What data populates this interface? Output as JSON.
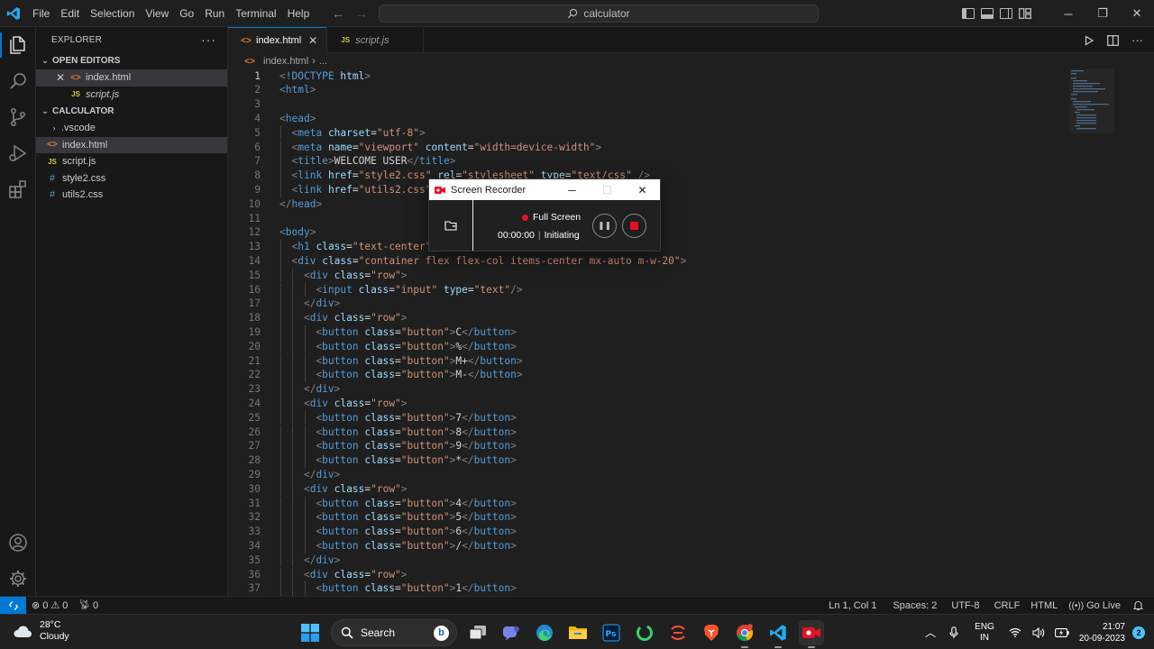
{
  "titlebar": {
    "menu": [
      "File",
      "Edit",
      "Selection",
      "View",
      "Go",
      "Run",
      "Terminal",
      "Help"
    ],
    "search_text": "calculator"
  },
  "explorer": {
    "title": "EXPLORER",
    "open_editors_label": "OPEN EDITORS",
    "open_editors": [
      {
        "name": "index.html",
        "type": "html"
      },
      {
        "name": "script.js",
        "type": "js"
      }
    ],
    "folder_label": "CALCULATOR",
    "files": [
      {
        "name": ".vscode",
        "type": "folder"
      },
      {
        "name": "index.html",
        "type": "html"
      },
      {
        "name": "script.js",
        "type": "js"
      },
      {
        "name": "style2.css",
        "type": "css"
      },
      {
        "name": "utils2.css",
        "type": "css"
      }
    ]
  },
  "tabs": [
    {
      "label": "index.html",
      "type": "html",
      "active": true
    },
    {
      "label": "script.js",
      "type": "js",
      "active": false
    }
  ],
  "breadcrumb": {
    "file": "index.html",
    "rest": "..."
  },
  "editor": {
    "current_line": 1,
    "lines": [
      [
        [
          "t-br",
          "<"
        ],
        [
          "t-doc",
          "!DOCTYPE"
        ],
        [
          "t-txt",
          " "
        ],
        [
          "t-attr",
          "html"
        ],
        [
          "t-br",
          ">"
        ]
      ],
      [
        [
          "t-br",
          "<"
        ],
        [
          "t-tag",
          "html"
        ],
        [
          "t-br",
          ">"
        ]
      ],
      [],
      [
        [
          "t-br",
          "<"
        ],
        [
          "t-tag",
          "head"
        ],
        [
          "t-br",
          ">"
        ]
      ],
      [
        [
          "t-txt",
          "  "
        ],
        [
          "t-br",
          "<"
        ],
        [
          "t-tag",
          "meta"
        ],
        [
          "t-txt",
          " "
        ],
        [
          "t-attr",
          "charset"
        ],
        [
          "t-txt",
          "="
        ],
        [
          "t-str",
          "\"utf-8\""
        ],
        [
          "t-br",
          ">"
        ]
      ],
      [
        [
          "t-txt",
          "  "
        ],
        [
          "t-br",
          "<"
        ],
        [
          "t-tag",
          "meta"
        ],
        [
          "t-txt",
          " "
        ],
        [
          "t-attr",
          "name"
        ],
        [
          "t-txt",
          "="
        ],
        [
          "t-str",
          "\"viewport\""
        ],
        [
          "t-txt",
          " "
        ],
        [
          "t-attr",
          "content"
        ],
        [
          "t-txt",
          "="
        ],
        [
          "t-str",
          "\"width=device-width\""
        ],
        [
          "t-br",
          ">"
        ]
      ],
      [
        [
          "t-txt",
          "  "
        ],
        [
          "t-br",
          "<"
        ],
        [
          "t-tag",
          "title"
        ],
        [
          "t-br",
          ">"
        ],
        [
          "t-txt",
          "WELCOME USER"
        ],
        [
          "t-br",
          "</"
        ],
        [
          "t-tag",
          "title"
        ],
        [
          "t-br",
          ">"
        ]
      ],
      [
        [
          "t-txt",
          "  "
        ],
        [
          "t-br",
          "<"
        ],
        [
          "t-tag",
          "link"
        ],
        [
          "t-txt",
          " "
        ],
        [
          "t-attr",
          "href"
        ],
        [
          "t-txt",
          "="
        ],
        [
          "t-str",
          "\"style2.css\""
        ],
        [
          "t-txt",
          " "
        ],
        [
          "t-attr",
          "rel"
        ],
        [
          "t-txt",
          "="
        ],
        [
          "t-str",
          "\"stylesheet\""
        ],
        [
          "t-txt",
          " "
        ],
        [
          "t-attr",
          "type"
        ],
        [
          "t-txt",
          "="
        ],
        [
          "t-str",
          "\"text/css\""
        ],
        [
          "t-txt",
          " "
        ],
        [
          "t-br",
          "/>"
        ]
      ],
      [
        [
          "t-txt",
          "  "
        ],
        [
          "t-br",
          "<"
        ],
        [
          "t-tag",
          "link"
        ],
        [
          "t-txt",
          " "
        ],
        [
          "t-attr",
          "href"
        ],
        [
          "t-txt",
          "="
        ],
        [
          "t-str",
          "\"utils2.css\""
        ]
      ],
      [
        [
          "t-br",
          "</"
        ],
        [
          "t-tag",
          "head"
        ],
        [
          "t-br",
          ">"
        ]
      ],
      [],
      [
        [
          "t-br",
          "<"
        ],
        [
          "t-tag",
          "body"
        ],
        [
          "t-br",
          ">"
        ]
      ],
      [
        [
          "t-txt",
          "  "
        ],
        [
          "t-br",
          "<"
        ],
        [
          "t-tag",
          "h1"
        ],
        [
          "t-txt",
          " "
        ],
        [
          "t-attr",
          "class"
        ],
        [
          "t-txt",
          "="
        ],
        [
          "t-str",
          "\"text-center\""
        ],
        [
          "t-br",
          ">"
        ]
      ],
      [
        [
          "t-txt",
          "  "
        ],
        [
          "t-br",
          "<"
        ],
        [
          "t-tag",
          "div"
        ],
        [
          "t-txt",
          " "
        ],
        [
          "t-attr",
          "class"
        ],
        [
          "t-txt",
          "="
        ],
        [
          "t-str",
          "\"container flex flex-col items-center mx-auto m-w-20\""
        ],
        [
          "t-br",
          ">"
        ]
      ],
      [
        [
          "t-txt",
          "    "
        ],
        [
          "t-br",
          "<"
        ],
        [
          "t-tag",
          "div"
        ],
        [
          "t-txt",
          " "
        ],
        [
          "t-attr",
          "class"
        ],
        [
          "t-txt",
          "="
        ],
        [
          "t-str",
          "\"row\""
        ],
        [
          "t-br",
          ">"
        ]
      ],
      [
        [
          "t-txt",
          "      "
        ],
        [
          "t-br",
          "<"
        ],
        [
          "t-tag",
          "input"
        ],
        [
          "t-txt",
          " "
        ],
        [
          "t-attr",
          "class"
        ],
        [
          "t-txt",
          "="
        ],
        [
          "t-str",
          "\"input\""
        ],
        [
          "t-txt",
          " "
        ],
        [
          "t-attr",
          "type"
        ],
        [
          "t-txt",
          "="
        ],
        [
          "t-str",
          "\"text\""
        ],
        [
          "t-br",
          "/>"
        ]
      ],
      [
        [
          "t-txt",
          "    "
        ],
        [
          "t-br",
          "</"
        ],
        [
          "t-tag",
          "div"
        ],
        [
          "t-br",
          ">"
        ]
      ],
      [
        [
          "t-txt",
          "    "
        ],
        [
          "t-br",
          "<"
        ],
        [
          "t-tag",
          "div"
        ],
        [
          "t-txt",
          " "
        ],
        [
          "t-attr",
          "class"
        ],
        [
          "t-txt",
          "="
        ],
        [
          "t-str",
          "\"row\""
        ],
        [
          "t-br",
          ">"
        ]
      ],
      [
        [
          "t-txt",
          "      "
        ],
        [
          "t-br",
          "<"
        ],
        [
          "t-tag",
          "button"
        ],
        [
          "t-txt",
          " "
        ],
        [
          "t-attr",
          "class"
        ],
        [
          "t-txt",
          "="
        ],
        [
          "t-str",
          "\"button\""
        ],
        [
          "t-br",
          ">"
        ],
        [
          "t-txt",
          "C"
        ],
        [
          "t-br",
          "</"
        ],
        [
          "t-tag",
          "button"
        ],
        [
          "t-br",
          ">"
        ]
      ],
      [
        [
          "t-txt",
          "      "
        ],
        [
          "t-br",
          "<"
        ],
        [
          "t-tag",
          "button"
        ],
        [
          "t-txt",
          " "
        ],
        [
          "t-attr",
          "class"
        ],
        [
          "t-txt",
          "="
        ],
        [
          "t-str",
          "\"button\""
        ],
        [
          "t-br",
          ">"
        ],
        [
          "t-txt",
          "%"
        ],
        [
          "t-br",
          "</"
        ],
        [
          "t-tag",
          "button"
        ],
        [
          "t-br",
          ">"
        ]
      ],
      [
        [
          "t-txt",
          "      "
        ],
        [
          "t-br",
          "<"
        ],
        [
          "t-tag",
          "button"
        ],
        [
          "t-txt",
          " "
        ],
        [
          "t-attr",
          "class"
        ],
        [
          "t-txt",
          "="
        ],
        [
          "t-str",
          "\"button\""
        ],
        [
          "t-br",
          ">"
        ],
        [
          "t-txt",
          "M+"
        ],
        [
          "t-br",
          "</"
        ],
        [
          "t-tag",
          "button"
        ],
        [
          "t-br",
          ">"
        ]
      ],
      [
        [
          "t-txt",
          "      "
        ],
        [
          "t-br",
          "<"
        ],
        [
          "t-tag",
          "button"
        ],
        [
          "t-txt",
          " "
        ],
        [
          "t-attr",
          "class"
        ],
        [
          "t-txt",
          "="
        ],
        [
          "t-str",
          "\"button\""
        ],
        [
          "t-br",
          ">"
        ],
        [
          "t-txt",
          "M-"
        ],
        [
          "t-br",
          "</"
        ],
        [
          "t-tag",
          "button"
        ],
        [
          "t-br",
          ">"
        ]
      ],
      [
        [
          "t-txt",
          "    "
        ],
        [
          "t-br",
          "</"
        ],
        [
          "t-tag",
          "div"
        ],
        [
          "t-br",
          ">"
        ]
      ],
      [
        [
          "t-txt",
          "    "
        ],
        [
          "t-br",
          "<"
        ],
        [
          "t-tag",
          "div"
        ],
        [
          "t-txt",
          " "
        ],
        [
          "t-attr",
          "class"
        ],
        [
          "t-txt",
          "="
        ],
        [
          "t-str",
          "\"row\""
        ],
        [
          "t-br",
          ">"
        ]
      ],
      [
        [
          "t-txt",
          "      "
        ],
        [
          "t-br",
          "<"
        ],
        [
          "t-tag",
          "button"
        ],
        [
          "t-txt",
          " "
        ],
        [
          "t-attr",
          "class"
        ],
        [
          "t-txt",
          "="
        ],
        [
          "t-str",
          "\"button\""
        ],
        [
          "t-br",
          ">"
        ],
        [
          "t-txt",
          "7"
        ],
        [
          "t-br",
          "</"
        ],
        [
          "t-tag",
          "button"
        ],
        [
          "t-br",
          ">"
        ]
      ],
      [
        [
          "t-txt",
          "      "
        ],
        [
          "t-br",
          "<"
        ],
        [
          "t-tag",
          "button"
        ],
        [
          "t-txt",
          " "
        ],
        [
          "t-attr",
          "class"
        ],
        [
          "t-txt",
          "="
        ],
        [
          "t-str",
          "\"button\""
        ],
        [
          "t-br",
          ">"
        ],
        [
          "t-txt",
          "8"
        ],
        [
          "t-br",
          "</"
        ],
        [
          "t-tag",
          "button"
        ],
        [
          "t-br",
          ">"
        ]
      ],
      [
        [
          "t-txt",
          "      "
        ],
        [
          "t-br",
          "<"
        ],
        [
          "t-tag",
          "button"
        ],
        [
          "t-txt",
          " "
        ],
        [
          "t-attr",
          "class"
        ],
        [
          "t-txt",
          "="
        ],
        [
          "t-str",
          "\"button\""
        ],
        [
          "t-br",
          ">"
        ],
        [
          "t-txt",
          "9"
        ],
        [
          "t-br",
          "</"
        ],
        [
          "t-tag",
          "button"
        ],
        [
          "t-br",
          ">"
        ]
      ],
      [
        [
          "t-txt",
          "      "
        ],
        [
          "t-br",
          "<"
        ],
        [
          "t-tag",
          "button"
        ],
        [
          "t-txt",
          " "
        ],
        [
          "t-attr",
          "class"
        ],
        [
          "t-txt",
          "="
        ],
        [
          "t-str",
          "\"button\""
        ],
        [
          "t-br",
          ">"
        ],
        [
          "t-txt",
          "*"
        ],
        [
          "t-br",
          "</"
        ],
        [
          "t-tag",
          "button"
        ],
        [
          "t-br",
          ">"
        ]
      ],
      [
        [
          "t-txt",
          "    "
        ],
        [
          "t-br",
          "</"
        ],
        [
          "t-tag",
          "div"
        ],
        [
          "t-br",
          ">"
        ]
      ],
      [
        [
          "t-txt",
          "    "
        ],
        [
          "t-br",
          "<"
        ],
        [
          "t-tag",
          "div"
        ],
        [
          "t-txt",
          " "
        ],
        [
          "t-attr",
          "class"
        ],
        [
          "t-txt",
          "="
        ],
        [
          "t-str",
          "\"row\""
        ],
        [
          "t-br",
          ">"
        ]
      ],
      [
        [
          "t-txt",
          "      "
        ],
        [
          "t-br",
          "<"
        ],
        [
          "t-tag",
          "button"
        ],
        [
          "t-txt",
          " "
        ],
        [
          "t-attr",
          "class"
        ],
        [
          "t-txt",
          "="
        ],
        [
          "t-str",
          "\"button\""
        ],
        [
          "t-br",
          ">"
        ],
        [
          "t-txt",
          "4"
        ],
        [
          "t-br",
          "</"
        ],
        [
          "t-tag",
          "button"
        ],
        [
          "t-br",
          ">"
        ]
      ],
      [
        [
          "t-txt",
          "      "
        ],
        [
          "t-br",
          "<"
        ],
        [
          "t-tag",
          "button"
        ],
        [
          "t-txt",
          " "
        ],
        [
          "t-attr",
          "class"
        ],
        [
          "t-txt",
          "="
        ],
        [
          "t-str",
          "\"button\""
        ],
        [
          "t-br",
          ">"
        ],
        [
          "t-txt",
          "5"
        ],
        [
          "t-br",
          "</"
        ],
        [
          "t-tag",
          "button"
        ],
        [
          "t-br",
          ">"
        ]
      ],
      [
        [
          "t-txt",
          "      "
        ],
        [
          "t-br",
          "<"
        ],
        [
          "t-tag",
          "button"
        ],
        [
          "t-txt",
          " "
        ],
        [
          "t-attr",
          "class"
        ],
        [
          "t-txt",
          "="
        ],
        [
          "t-str",
          "\"button\""
        ],
        [
          "t-br",
          ">"
        ],
        [
          "t-txt",
          "6"
        ],
        [
          "t-br",
          "</"
        ],
        [
          "t-tag",
          "button"
        ],
        [
          "t-br",
          ">"
        ]
      ],
      [
        [
          "t-txt",
          "      "
        ],
        [
          "t-br",
          "<"
        ],
        [
          "t-tag",
          "button"
        ],
        [
          "t-txt",
          " "
        ],
        [
          "t-attr",
          "class"
        ],
        [
          "t-txt",
          "="
        ],
        [
          "t-str",
          "\"button\""
        ],
        [
          "t-br",
          ">"
        ],
        [
          "t-txt",
          "/"
        ],
        [
          "t-br",
          "</"
        ],
        [
          "t-tag",
          "button"
        ],
        [
          "t-br",
          ">"
        ]
      ],
      [
        [
          "t-txt",
          "    "
        ],
        [
          "t-br",
          "</"
        ],
        [
          "t-tag",
          "div"
        ],
        [
          "t-br",
          ">"
        ]
      ],
      [
        [
          "t-txt",
          "    "
        ],
        [
          "t-br",
          "<"
        ],
        [
          "t-tag",
          "div"
        ],
        [
          "t-txt",
          " "
        ],
        [
          "t-attr",
          "class"
        ],
        [
          "t-txt",
          "="
        ],
        [
          "t-str",
          "\"row\""
        ],
        [
          "t-br",
          ">"
        ]
      ],
      [
        [
          "t-txt",
          "      "
        ],
        [
          "t-br",
          "<"
        ],
        [
          "t-tag",
          "button"
        ],
        [
          "t-txt",
          " "
        ],
        [
          "t-attr",
          "class"
        ],
        [
          "t-txt",
          "="
        ],
        [
          "t-str",
          "\"button\""
        ],
        [
          "t-br",
          ">"
        ],
        [
          "t-txt",
          "1"
        ],
        [
          "t-br",
          "</"
        ],
        [
          "t-tag",
          "button"
        ],
        [
          "t-br",
          ">"
        ]
      ]
    ]
  },
  "recorder": {
    "title": "Screen Recorder",
    "mode": "Full Screen",
    "time": "00:00:00",
    "status": "Initiating",
    "accent": "#e81123"
  },
  "statusbar": {
    "errors": "0",
    "warnings": "0",
    "ports": "0",
    "position": "Ln 1, Col 1",
    "spaces": "Spaces: 2",
    "encoding": "UTF-8",
    "eol": "CRLF",
    "language": "HTML",
    "go_live": "Go Live",
    "accent": "#0078d4"
  },
  "taskbar": {
    "temperature": "28°C",
    "condition": "Cloudy",
    "search": "Search",
    "lang_line1": "ENG",
    "lang_line2": "IN",
    "time": "21:07",
    "date": "20-09-2023",
    "notifications": "2"
  }
}
